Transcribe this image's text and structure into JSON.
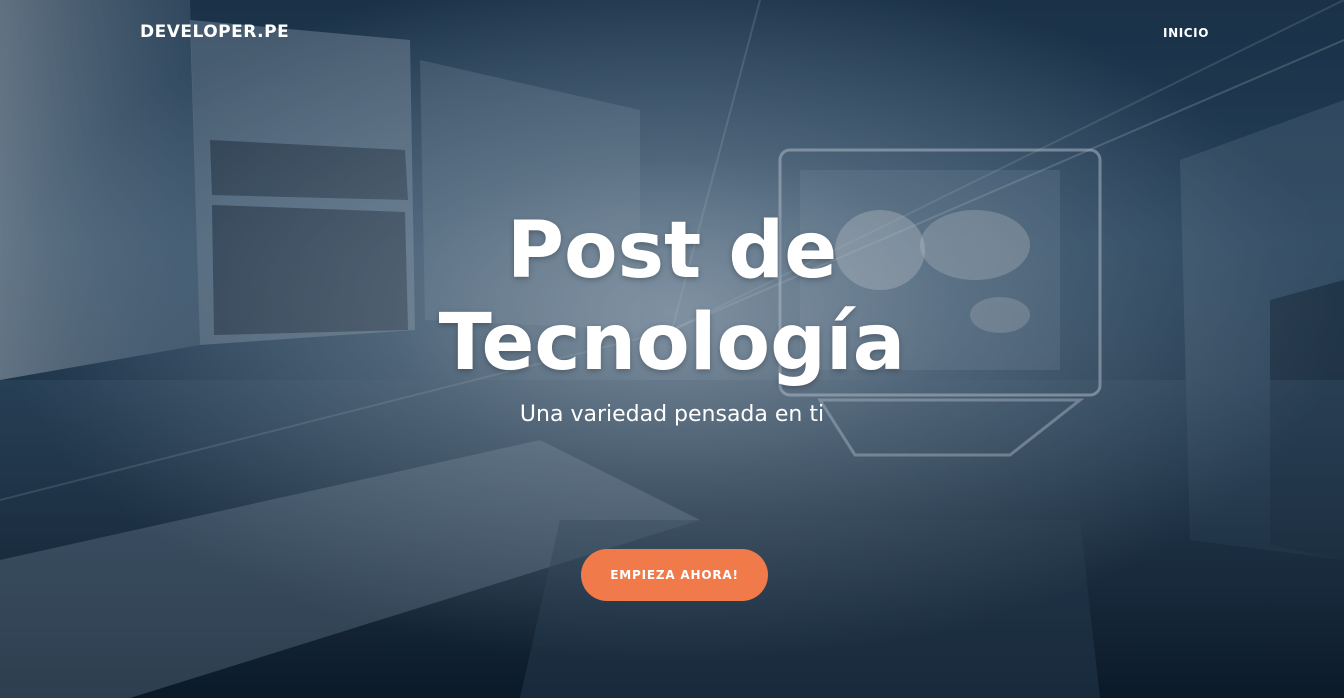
{
  "navbar": {
    "brand": "DEVELOPER.PE",
    "links": [
      {
        "label": "INICIO"
      }
    ]
  },
  "hero": {
    "title_line_1": "Post de",
    "title_line_2": "Tecnología",
    "subtitle": "Una variedad pensada en ti",
    "cta_label": "EMPIEZA AHORA!"
  },
  "colors": {
    "cta_background": "#f07a4a",
    "text": "#ffffff",
    "background_tint": "#1f3a52"
  }
}
